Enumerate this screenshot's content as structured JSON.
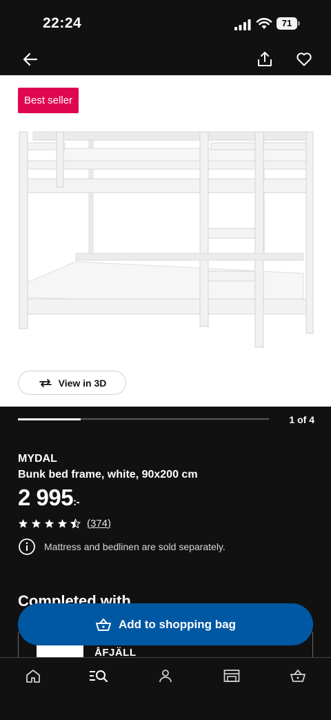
{
  "status_bar": {
    "time": "22:24",
    "battery_level": "71",
    "icons": [
      "signal-icon",
      "wifi-icon",
      "battery-icon"
    ]
  },
  "nav": {
    "icons": [
      "back-arrow-icon",
      "share-icon",
      "heart-icon"
    ]
  },
  "gallery": {
    "badge": "Best seller",
    "view_3d_label": "View in 3D",
    "page_indicator": "1 of 4",
    "progress_fraction": 0.25
  },
  "product": {
    "name": "MYDAL",
    "description": "Bunk bed frame, white, 90x200 cm",
    "price": "2 995",
    "price_suffix": ":-",
    "rating_stars": 4.5,
    "review_count": "(374)",
    "info_note": "Mattress and bedlinen are sold separately."
  },
  "completed_with": {
    "title": "Completed with",
    "item_name": "ÅFJÄLL"
  },
  "cta": {
    "add_to_bag_label": "Add to shopping bag"
  },
  "tab_bar": {
    "icons": [
      "home-icon",
      "search-icon",
      "profile-icon",
      "store-icon",
      "basket-icon"
    ]
  },
  "colors": {
    "background": "#111111",
    "badge": "#e00751",
    "primary_button": "#0058a3",
    "image_bg": "#ffffff"
  }
}
